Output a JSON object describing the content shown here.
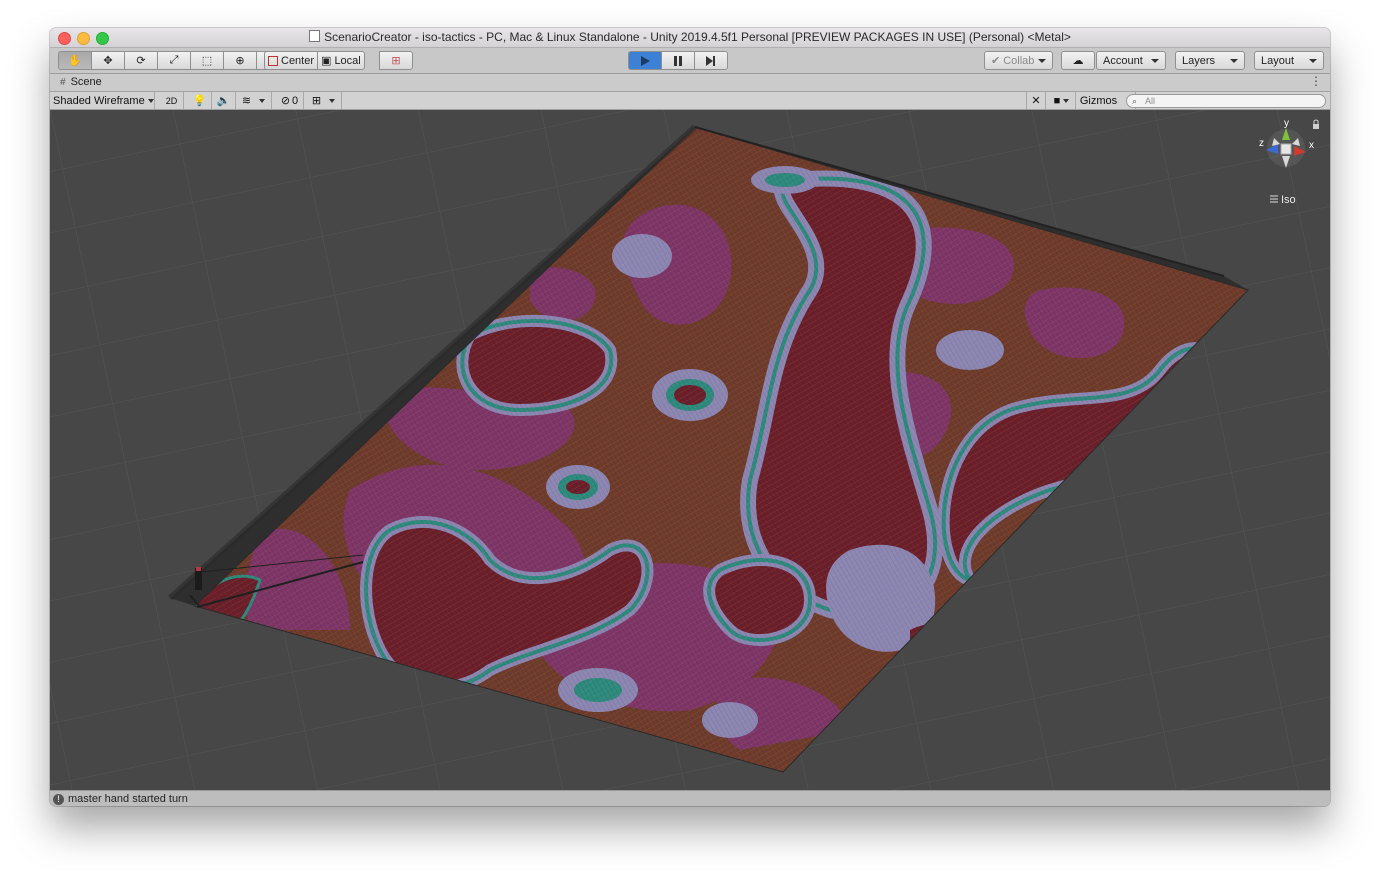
{
  "window": {
    "title": "ScenarioCreator - iso-tactics - PC, Mac & Linux Standalone - Unity 2019.4.5f1 Personal [PREVIEW PACKAGES IN USE] (Personal) <Metal>"
  },
  "toolbar": {
    "tools": [
      {
        "name": "hand-tool",
        "icon": "hand-icon",
        "glyph": "✋",
        "active": true
      },
      {
        "name": "move-tool",
        "icon": "move-icon",
        "glyph": "✥"
      },
      {
        "name": "rotate-tool",
        "icon": "rotate-icon",
        "glyph": "⟳"
      },
      {
        "name": "scale-tool",
        "icon": "scale-icon",
        "glyph": "⤢"
      },
      {
        "name": "rect-tool",
        "icon": "rect-icon",
        "glyph": "⬚"
      },
      {
        "name": "transform-tool",
        "icon": "transform-icon",
        "glyph": "⊕"
      },
      {
        "name": "custom-tool",
        "icon": "tools-icon",
        "glyph": "✂"
      }
    ],
    "pivot_label": "Center",
    "space_label": "Local",
    "collab_label": "Collab",
    "account_label": "Account",
    "layers_label": "Layers",
    "layout_label": "Layout",
    "play_color": "#3c81d6"
  },
  "scene_tab": {
    "label": "Scene"
  },
  "scene_toolbar": {
    "shading_mode": "Shaded Wireframe",
    "mode_2d": "2D",
    "hidden_count": "0",
    "gizmos_label": "Gizmos",
    "search_placeholder": "All"
  },
  "gizmo": {
    "axis_y": "y",
    "axis_x": "x",
    "axis_z": "z",
    "projection": "Iso",
    "colors": {
      "x": "#d43a2f",
      "y": "#7cc23a",
      "z": "#3a6ad4"
    }
  },
  "terrain_colors": {
    "base": "#6e3b2c",
    "magenta": "#7e3568",
    "maroon": "#6b1f2b",
    "lavender": "#8b86b3",
    "teal": "#2c8a7e",
    "background": "#474747"
  },
  "status": {
    "message": "master hand started turn"
  }
}
